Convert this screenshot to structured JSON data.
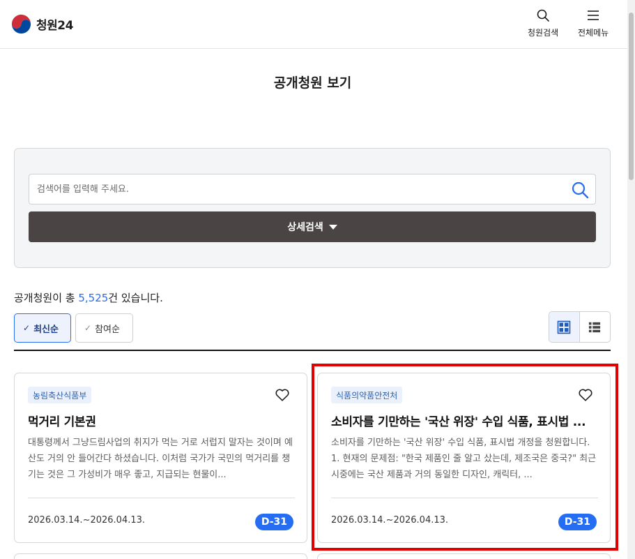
{
  "header": {
    "logo_text": "청원24",
    "search_label": "청원검색",
    "menu_label": "전체메뉴"
  },
  "page_title": "공개청원 보기",
  "search": {
    "placeholder": "검색어를 입력해 주세요.",
    "value": "",
    "advanced_label": "상세검색"
  },
  "summary": {
    "prefix": "공개청원이 총 ",
    "count": "5,525",
    "suffix": "건 있습니다."
  },
  "sort": {
    "options": [
      {
        "label": "최신순",
        "selected": true
      },
      {
        "label": "참여순",
        "selected": false
      }
    ]
  },
  "view_modes": [
    {
      "icon": "grid-view-icon",
      "selected": true
    },
    {
      "icon": "list-view-icon",
      "selected": false
    }
  ],
  "cards": [
    {
      "agency": "농림축산식품부",
      "title": "먹거리 기본권",
      "description": "대통령께서 그냥드림사업의 취지가 먹는 거로 서럽지 말자는 것이며 예산도 거의 안 들어간다 하셨습니다. 이처럼 국가가 국민의 먹거리를 챙기는 것은 그 가성비가 매우 좋고, 지급되는 현물이...",
      "period": "2026.03.14.~2026.04.13.",
      "dday": "D-31",
      "favorited": false
    },
    {
      "agency": "식품의약품안전처",
      "title": "소비자를 기만하는 '국산 위장' 수입 식품, 표시법 ...",
      "description": "소비자를 기만하는 '국산 위장' 수입 식품, 표시법 개정을 청원합니다. 1. 현재의 문제점: \"한국 제품인 줄 알고 샀는데, 제조국은 중국?\" 최근 시중에는 국산 제품과 거의 동일한 디자인, 캐릭터, ...",
      "period": "2026.03.14.~2026.04.13.",
      "dday": "D-31",
      "favorited": false
    }
  ],
  "colors": {
    "accent": "#256ef4",
    "tag_bg": "#eaf1fd",
    "advanced_button_bg": "#4a4444",
    "highlight": "#e30000"
  }
}
